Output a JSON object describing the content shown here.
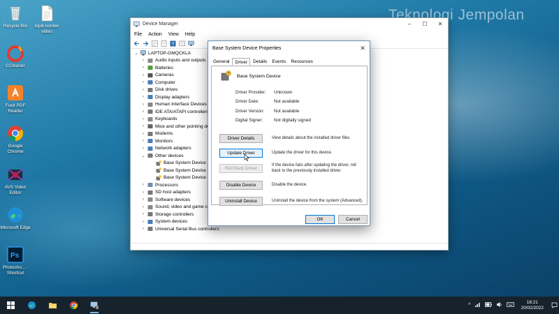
{
  "watermark": "Teknologi Jempolan",
  "desktop": {
    "icons": [
      {
        "label": "Recycle Bin",
        "icon": "recycle-bin-icon"
      },
      {
        "label": "topik konten video",
        "icon": "document-icon"
      },
      {
        "label": "CCleaner",
        "icon": "ccleaner-icon"
      },
      {
        "label": "Foxit PDF Reader",
        "icon": "foxit-icon"
      },
      {
        "label": "Google Chrome",
        "icon": "chrome-icon"
      },
      {
        "label": "AVS Video Editor",
        "icon": "avs-icon"
      },
      {
        "label": "Microsoft Edge",
        "icon": "edge-icon"
      },
      {
        "label": "Photosho... - Shortcut",
        "icon": "photoshop-icon"
      }
    ]
  },
  "device_manager": {
    "title": "Device Manager",
    "menu": [
      "File",
      "Action",
      "View",
      "Help"
    ],
    "tree": {
      "root": "LAPTOP-GMQCKLA",
      "categories": [
        "Audio inputs and outputs",
        "Batteries",
        "Cameras",
        "Computer",
        "Disk drives",
        "Display adapters",
        "Human Interface Devices",
        "IDE ATA/ATAPI controllers",
        "Keyboards",
        "Mice and other pointing devices",
        "Modems",
        "Monitors",
        "Network adapters",
        "Other devices",
        "Base System Device",
        "Base System Device",
        "Base System Device",
        "Processors",
        "SD host adapters",
        "Software devices",
        "Sound, video and game controllers",
        "Storage controllers",
        "System devices",
        "Universal Serial Bus controllers"
      ]
    }
  },
  "dialog": {
    "title": "Base System Device Properties",
    "close": "✕",
    "tabs": [
      "General",
      "Driver",
      "Details",
      "Events",
      "Resources"
    ],
    "active_tab": "Driver",
    "device_name": "Base System Device",
    "properties": [
      {
        "key": "Driver Provider:",
        "value": "Unknown"
      },
      {
        "key": "Driver Date:",
        "value": "Not available"
      },
      {
        "key": "Driver Version:",
        "value": "Not available"
      },
      {
        "key": "Digital Signer:",
        "value": "Not digitally signed"
      }
    ],
    "actions": [
      {
        "label": "Driver Details",
        "desc": "View details about the installed driver files.",
        "enabled": true
      },
      {
        "label": "Update Driver",
        "desc": "Update the driver for this device.",
        "enabled": true
      },
      {
        "label": "Roll Back Driver",
        "desc": "If the device fails after updating the driver, roll back to the previously installed driver.",
        "enabled": false
      },
      {
        "label": "Disable Device",
        "desc": "Disable the device.",
        "enabled": true
      },
      {
        "label": "Uninstall Device",
        "desc": "Uninstall the device from the system (Advanced).",
        "enabled": true
      }
    ],
    "ok": "OK",
    "cancel": "Cancel"
  },
  "taskbar": {
    "apps": [
      "start-icon",
      "edge-icon",
      "file-explorer-icon",
      "chrome-icon",
      "device-manager-icon"
    ],
    "tray": {
      "caret": "^",
      "time": "18:21",
      "date": "20/02/2022"
    }
  }
}
